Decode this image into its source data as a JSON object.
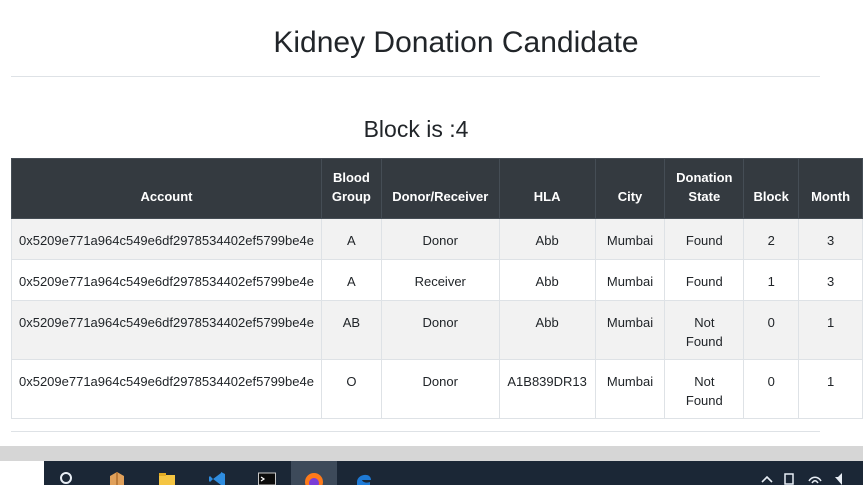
{
  "page": {
    "title": "Kidney Donation Candidate",
    "block_label": "Block is :4"
  },
  "table": {
    "headers": [
      "Account",
      "Blood Group",
      "Donor/Receiver",
      "HLA",
      "City",
      "Donation State",
      "Block",
      "Month"
    ],
    "rows": [
      [
        "0x5209e771a964c549e6df2978534402ef5799be4e",
        "A",
        "Donor",
        "Abb",
        "Mumbai",
        "Found",
        "2",
        "3"
      ],
      [
        "0x5209e771a964c549e6df2978534402ef5799be4e",
        "A",
        "Receiver",
        "Abb",
        "Mumbai",
        "Found",
        "1",
        "3"
      ],
      [
        "0x5209e771a964c549e6df2978534402ef5799be4e",
        "AB",
        "Donor",
        "Abb",
        "Mumbai",
        "Not Found",
        "0",
        "1"
      ],
      [
        "0x5209e771a964c549e6df2978534402ef5799be4e",
        "O",
        "Donor",
        "A1B839DR13",
        "Mumbai",
        "Not Found",
        "0",
        "1"
      ]
    ]
  },
  "taskbar": {
    "icons": [
      "search-icon",
      "package-icon",
      "file-explorer-icon",
      "vscode-icon",
      "terminal-icon",
      "firefox-icon",
      "edge-icon"
    ],
    "tray_icons": [
      "chevron-up-icon",
      "network-icon",
      "wifi-icon",
      "volume-icon"
    ]
  },
  "colors": {
    "header_bg": "#343a40",
    "striped_row": "#f2f2f2",
    "taskbar_bg": "#1b2736",
    "edge_blue": "#1e7ad6",
    "vscode_blue": "#2f8de0",
    "folder_yellow": "#f5c542",
    "firefox_orange": "#ff7a1a"
  }
}
